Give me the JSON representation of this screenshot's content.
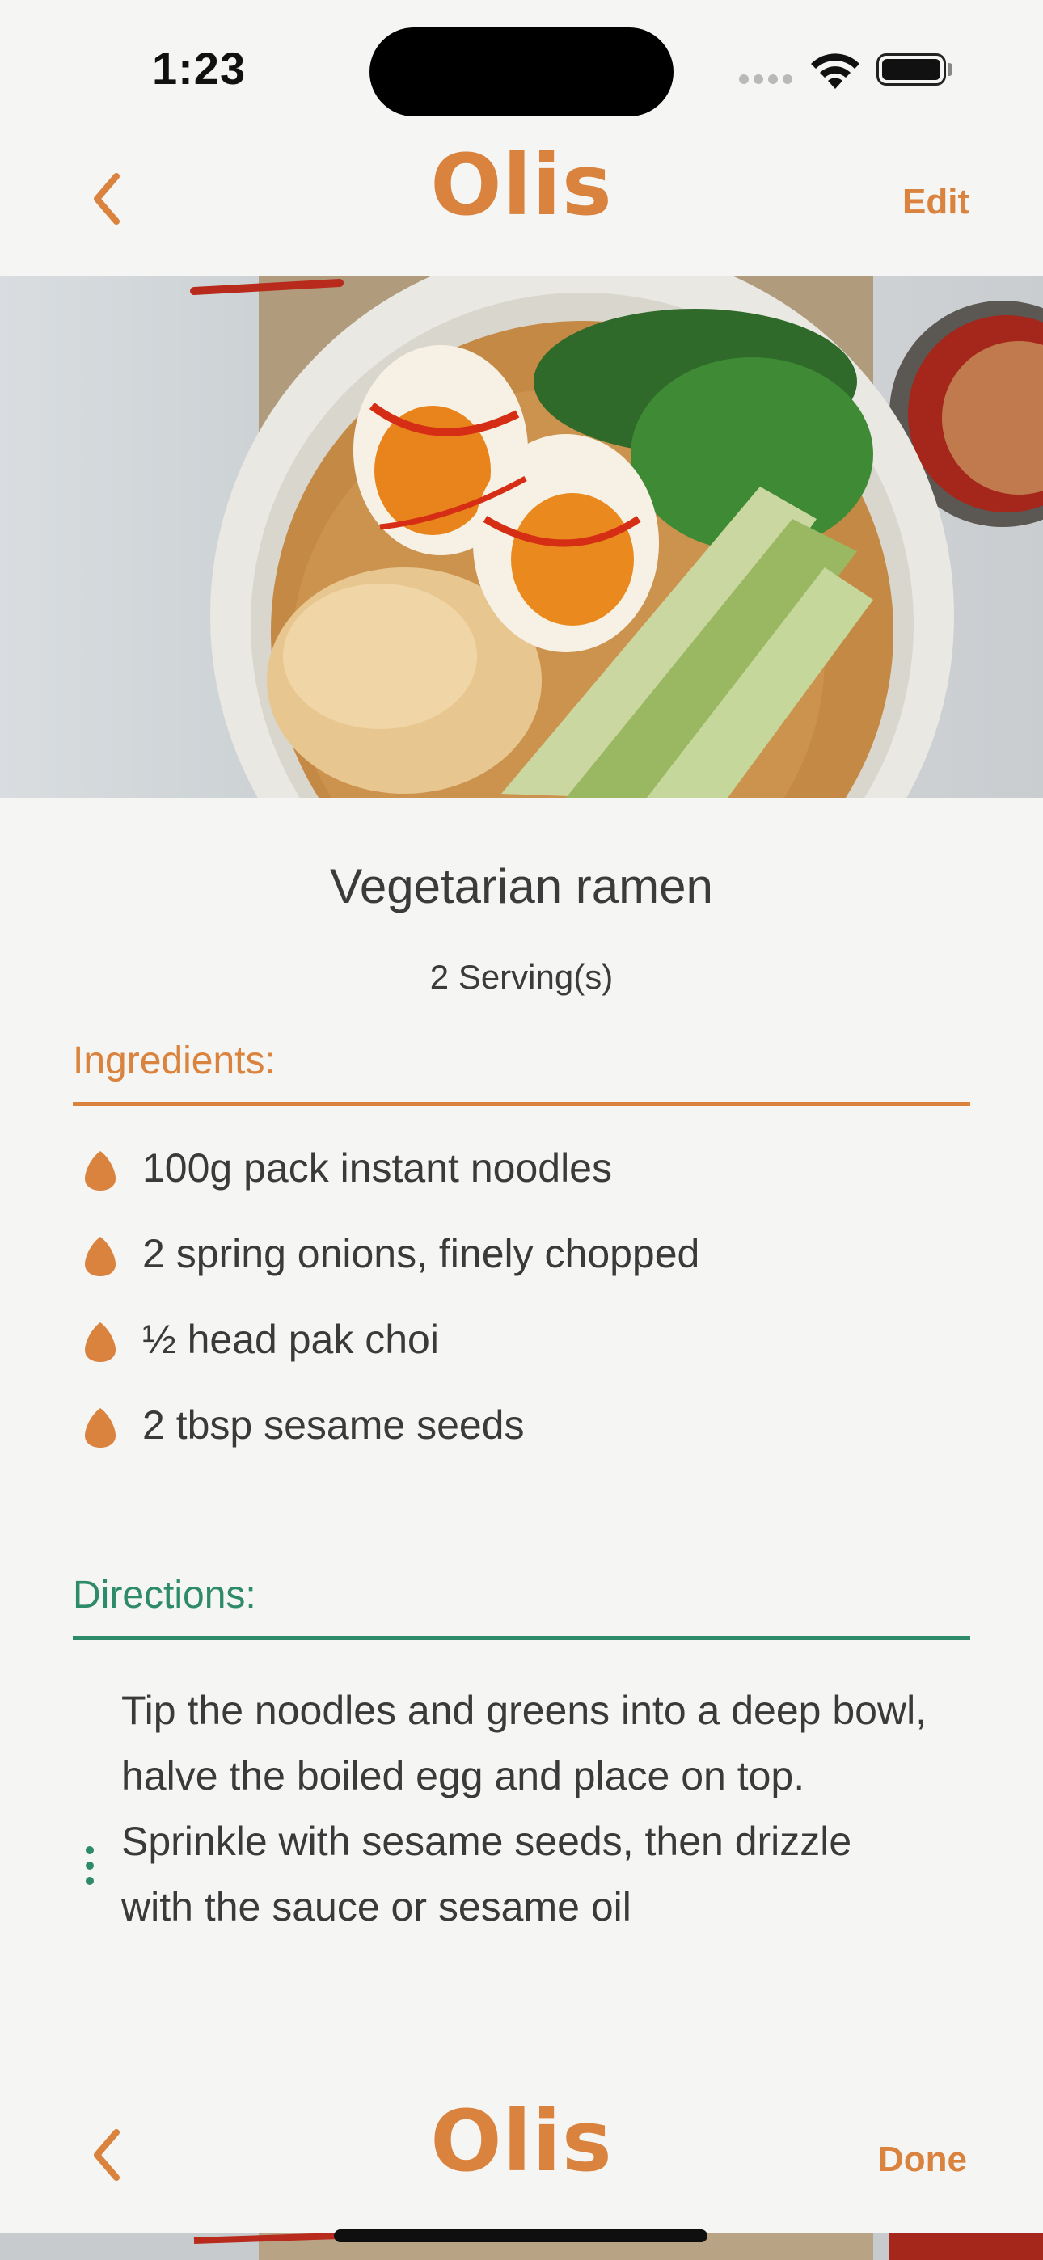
{
  "status_bar": {
    "time": "1:23"
  },
  "top_nav": {
    "title": "Olis",
    "right_label": "Edit"
  },
  "recipe": {
    "title": "Vegetarian ramen",
    "servings_count": "2",
    "servings_label": "Serving(s)"
  },
  "ingredients": {
    "header": "Ingredients:",
    "items": [
      "100g pack instant noodles",
      "2 spring onions, finely chopped",
      "½ head pak choi",
      "2 tbsp sesame seeds"
    ]
  },
  "directions": {
    "header": "Directions:",
    "text": "Tip the noodles and greens into a deep bowl, halve the boiled egg and place on top. Sprinkle with sesame seeds, then drizzle with the sauce or sesame oil"
  },
  "bottom_nav": {
    "title": "Olis",
    "right_label": "Done"
  },
  "colors": {
    "accent_orange": "#d9833e",
    "accent_green": "#2d8a6a",
    "background": "#f5f5f3",
    "text": "#3a3a3a"
  }
}
